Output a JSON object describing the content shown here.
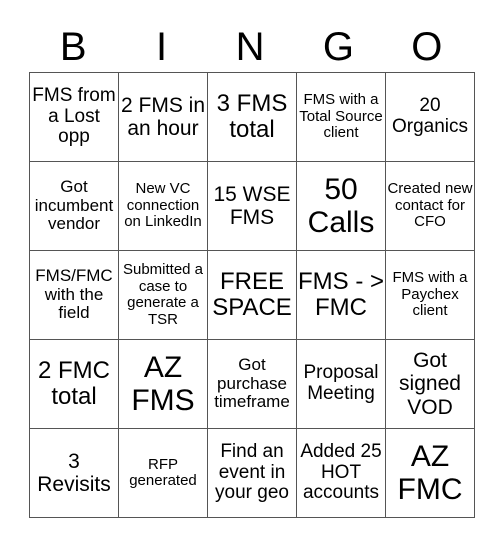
{
  "header": {
    "letters": [
      "B",
      "I",
      "N",
      "G",
      "O"
    ]
  },
  "board": {
    "rows": [
      [
        "FMS from a Lost opp",
        "2 FMS in an hour",
        "3 FMS total",
        "FMS with a Total Source client",
        "20 Organics"
      ],
      [
        "Got incumbent vendor",
        "New VC connection on LinkedIn",
        "15 WSE FMS",
        "50 Calls",
        "Created new contact for CFO"
      ],
      [
        "FMS/FMC with the field",
        "Submitted a case to generate a TSR",
        "FREE SPACE",
        "FMS - > FMC",
        "FMS with a Paychex client"
      ],
      [
        "2 FMC total",
        "AZ FMS",
        "Got purchase timeframe",
        "Proposal Meeting",
        "Got signed VOD"
      ],
      [
        "3 Revisits",
        "RFP generated",
        "Find an event in your geo",
        "Added 25 HOT accounts",
        "AZ FMC"
      ]
    ]
  }
}
